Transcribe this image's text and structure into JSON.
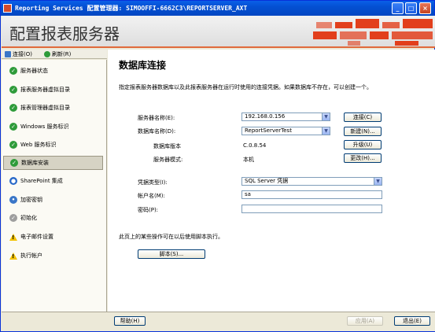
{
  "window": {
    "title": "Reporting Services 配置管理器: SIMOOFFI-6662C3\\REPORTSERVER_AXT",
    "controls": {
      "minimize": "_",
      "maximize": "□",
      "close": "×"
    }
  },
  "banner": {
    "title": "配置报表服务器"
  },
  "toolbar": {
    "connect_label": "连接(O)",
    "refresh_label": "刷新(R)"
  },
  "sidebar": {
    "items": [
      {
        "label": "服务器状态",
        "icon": "check"
      },
      {
        "label": "报表服务器虚拟目录",
        "icon": "check"
      },
      {
        "label": "报表管理器虚拟目录",
        "icon": "check"
      },
      {
        "label": "Windows 服务标识",
        "icon": "check"
      },
      {
        "label": "Web 服务标识",
        "icon": "check"
      },
      {
        "label": "数据库安装",
        "icon": "check",
        "selected": true
      },
      {
        "label": "SharePoint 集成",
        "icon": "globe"
      },
      {
        "label": "加密密钥",
        "icon": "key"
      },
      {
        "label": "初始化",
        "icon": "gray"
      },
      {
        "label": "电子邮件设置",
        "icon": "warning"
      },
      {
        "label": "执行帐户",
        "icon": "warning"
      }
    ]
  },
  "main": {
    "title": "数据库连接",
    "description": "指定报表服务器数据库以及此报表服务器在运行时使用的连接凭据。如果数据库不存在，可以创建一个。",
    "server_name_label": "服务器名称(E):",
    "server_name_value": "192.168.0.156",
    "connect_button": "连接(C)",
    "db_name_label": "数据库名称(D):",
    "db_name_value": "ReportServerTest",
    "new_button": "新建(N)...",
    "db_version_label": "数据库版本",
    "db_version_value": "C.0.8.54",
    "upgrade_button": "升级(U)",
    "server_mode_label": "服务器模式:",
    "server_mode_value": "本机",
    "change_button": "更改(H)...",
    "cred_type_label": "凭据类型(I):",
    "cred_type_value": "SQL Server 凭据",
    "account_label": "帐户名(M):",
    "account_value": "sa",
    "password_label": "密码(P):",
    "password_value": "",
    "note": "此页上的某些操作可在以后使用脚本执行。",
    "script_button": "脚本(S)..."
  },
  "footer": {
    "help_button": "帮助(H)",
    "apply_button": "应用(A)",
    "exit_button": "退出(E)"
  },
  "colors": {
    "accent": "#e23f1c",
    "titlebar": "#0450d2",
    "selected": "#d6d3c4"
  }
}
